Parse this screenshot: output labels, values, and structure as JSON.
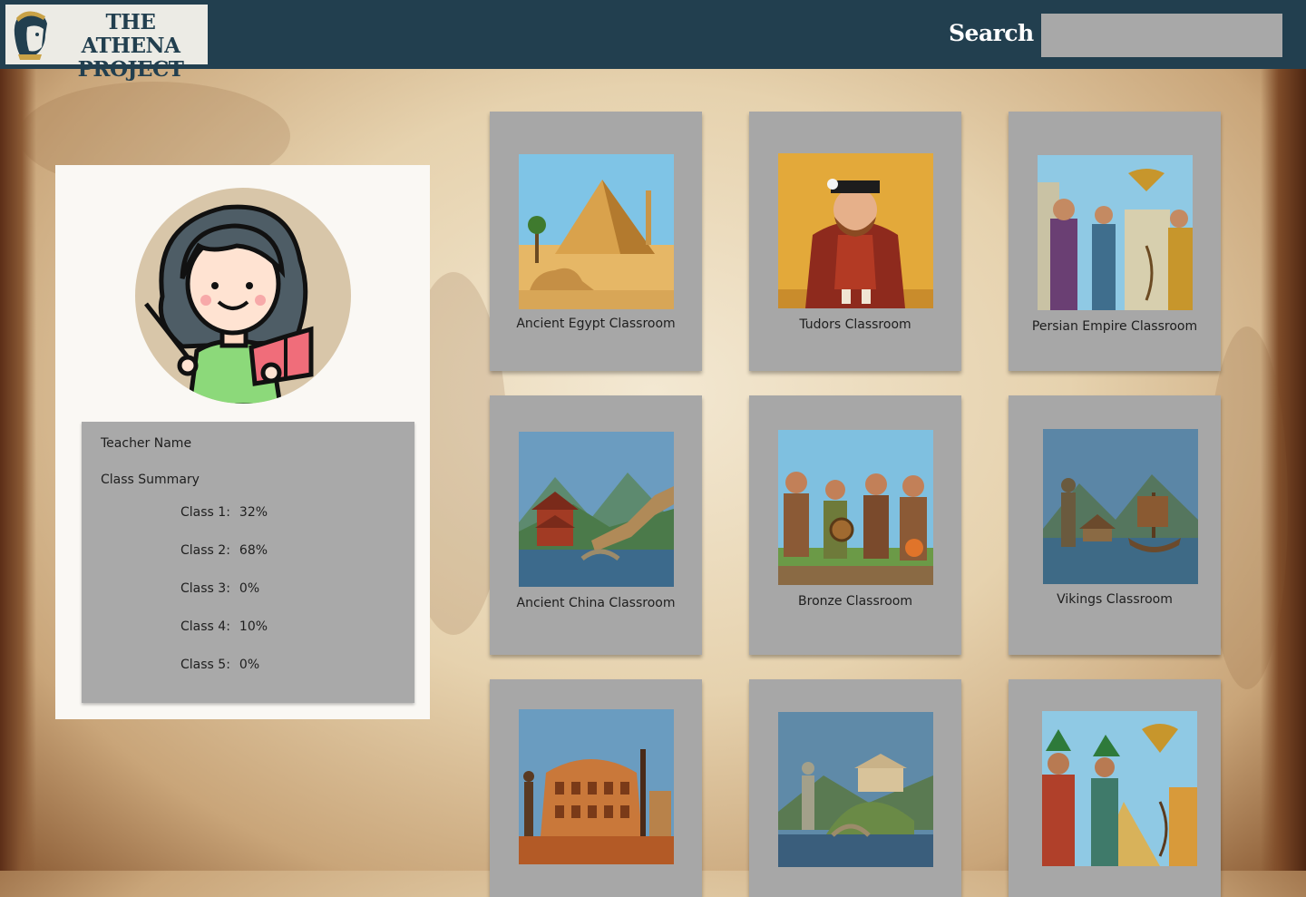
{
  "header": {
    "logo_line1": "THE ATHENA",
    "logo_line2": "PROJECT",
    "search_label": "Search",
    "search_value": ""
  },
  "teacher": {
    "name_label": "Teacher Name",
    "summary_title": "Class Summary",
    "classes": [
      {
        "label": "Class 1:",
        "value": "32%"
      },
      {
        "label": "Class 2:",
        "value": "68%"
      },
      {
        "label": "Class 3:",
        "value": "0%"
      },
      {
        "label": "Class 4:",
        "value": "10%"
      },
      {
        "label": "Class 5:",
        "value": "0%"
      }
    ]
  },
  "classrooms": [
    {
      "title": "Ancient Egypt Classroom",
      "image": "pyramid-sphinx-image"
    },
    {
      "title": "Tudors Classroom",
      "image": "tudor-king-image"
    },
    {
      "title": "Persian Empire Classroom",
      "image": "persian-figures-image"
    },
    {
      "title": "Ancient China Classroom",
      "image": "pagoda-great-wall-image"
    },
    {
      "title": "Bronze Classroom",
      "image": "bronze-age-people-image"
    },
    {
      "title": "Vikings Classroom",
      "image": "viking-ship-image"
    },
    {
      "title": "",
      "image": "colosseum-image"
    },
    {
      "title": "",
      "image": "greek-temple-image"
    },
    {
      "title": "",
      "image": "aztec-figures-image"
    }
  ],
  "colors": {
    "header_bg": "#223f4f",
    "card_bg": "#a7a7a7",
    "panel_bg": "#faf8f4"
  }
}
